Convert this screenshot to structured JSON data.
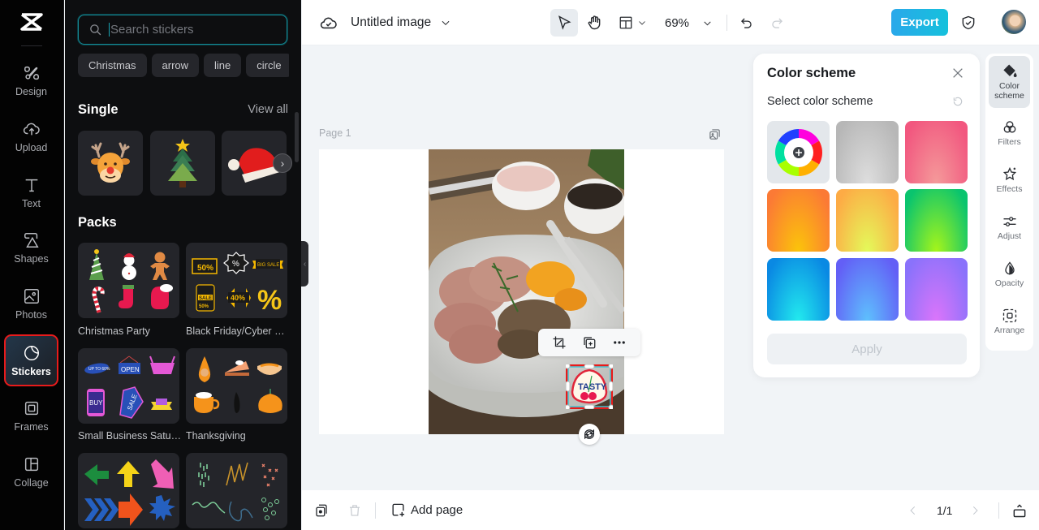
{
  "rail": {
    "items": [
      {
        "label": "Design",
        "icon": "design-icon"
      },
      {
        "label": "Upload",
        "icon": "upload-cloud-icon"
      },
      {
        "label": "Text",
        "icon": "text-icon"
      },
      {
        "label": "Shapes",
        "icon": "shapes-icon"
      },
      {
        "label": "Photos",
        "icon": "photo-icon"
      },
      {
        "label": "Stickers",
        "icon": "sticker-icon",
        "active": true
      },
      {
        "label": "Frames",
        "icon": "frame-icon"
      },
      {
        "label": "Collage",
        "icon": "collage-icon"
      }
    ]
  },
  "panel": {
    "search_placeholder": "Search stickers",
    "chips": [
      "Christmas",
      "arrow",
      "line",
      "circle"
    ],
    "single_title": "Single",
    "view_all": "View all",
    "single_items": [
      "reindeer",
      "christmas-tree",
      "santa-hat"
    ],
    "packs_title": "Packs",
    "packs": [
      {
        "label": "Christmas Party"
      },
      {
        "label": "Black Friday/Cyber Monday"
      },
      {
        "label": "Small Business Saturday"
      },
      {
        "label": "Thanksgiving"
      },
      {
        "label": ""
      },
      {
        "label": ""
      }
    ]
  },
  "topbar": {
    "title": "Untitled image",
    "zoom": "69%",
    "export_label": "Export"
  },
  "canvas": {
    "page_label": "Page 1",
    "sticker_text": "TASTY"
  },
  "color_scheme": {
    "title": "Color scheme",
    "subtitle": "Select color scheme",
    "apply_label": "Apply",
    "swatches": [
      {
        "name": "custom",
        "colors": [
          "#e3e7eb"
        ]
      },
      {
        "name": "gray",
        "colors": [
          "#b7b7b7",
          "#dedede"
        ]
      },
      {
        "name": "pink",
        "colors": [
          "#f2577f",
          "#f49a9a"
        ]
      },
      {
        "name": "orange",
        "colors": [
          "#fb7a35",
          "#fbc40a"
        ]
      },
      {
        "name": "yellow",
        "colors": [
          "#fdab45",
          "#e4fa5a"
        ]
      },
      {
        "name": "green",
        "colors": [
          "#0ac46e",
          "#a6f51a"
        ]
      },
      {
        "name": "blue",
        "colors": [
          "#0a89e3",
          "#22eaee"
        ]
      },
      {
        "name": "indigo",
        "colors": [
          "#635ff6",
          "#5ec0fd"
        ]
      },
      {
        "name": "purple",
        "colors": [
          "#8a72fb",
          "#db75fa"
        ]
      }
    ]
  },
  "tool_rail": {
    "items": [
      {
        "label": "Color scheme",
        "icon": "paint-bucket-icon",
        "active": true
      },
      {
        "label": "Filters",
        "icon": "filters-icon"
      },
      {
        "label": "Effects",
        "icon": "effects-star-icon"
      },
      {
        "label": "Adjust",
        "icon": "sliders-icon"
      },
      {
        "label": "Opacity",
        "icon": "opacity-drop-icon"
      },
      {
        "label": "Arrange",
        "icon": "arrange-icon"
      }
    ]
  },
  "bottombar": {
    "add_page_label": "Add page",
    "page_count": "1/1"
  }
}
